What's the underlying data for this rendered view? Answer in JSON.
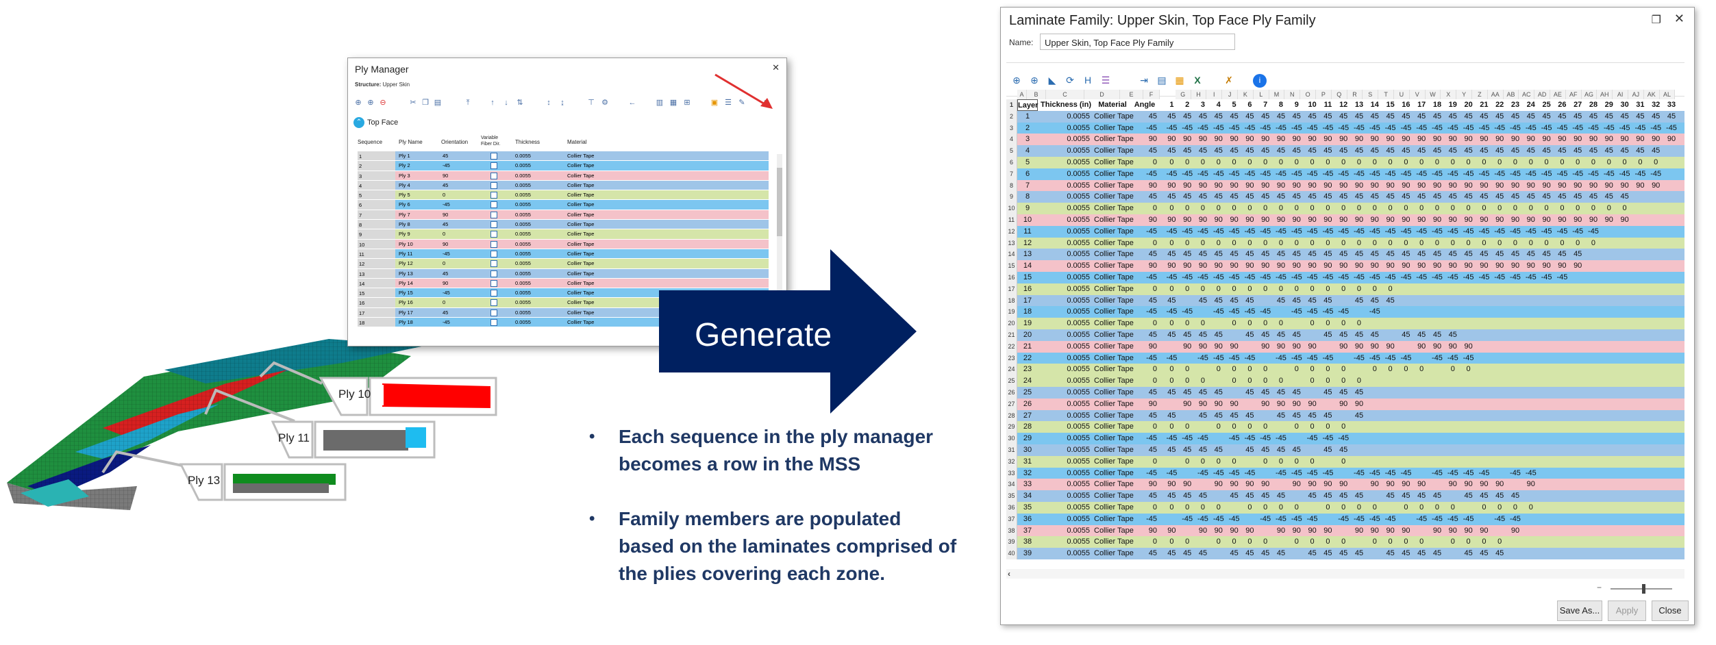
{
  "ply_manager": {
    "title": "Ply Manager",
    "structure_label": "Structure:",
    "structure_value": "Upper Skin",
    "group": "Top Face",
    "columns": [
      "Sequence",
      "Ply Name",
      "Orientation",
      "Variable Fiber Dir.",
      "Thickness",
      "Material"
    ],
    "rows": [
      {
        "seq": "1",
        "name": "Ply 1",
        "orient": "45",
        "thick": "0.0055",
        "mat": "Collier Tape",
        "color": "#9fc5e8"
      },
      {
        "seq": "2",
        "name": "Ply 2",
        "orient": "-45",
        "thick": "0.0055",
        "mat": "Collier Tape",
        "color": "#7cc6f0"
      },
      {
        "seq": "3",
        "name": "Ply 3",
        "orient": "90",
        "thick": "0.0055",
        "mat": "Collier Tape",
        "color": "#f4c2c9"
      },
      {
        "seq": "4",
        "name": "Ply 4",
        "orient": "45",
        "thick": "0.0055",
        "mat": "Collier Tape",
        "color": "#9fc5e8"
      },
      {
        "seq": "5",
        "name": "Ply 5",
        "orient": "0",
        "thick": "0.0055",
        "mat": "Collier Tape",
        "color": "#d5e5a9"
      },
      {
        "seq": "6",
        "name": "Ply 6",
        "orient": "-45",
        "thick": "0.0055",
        "mat": "Collier Tape",
        "color": "#7cc6f0"
      },
      {
        "seq": "7",
        "name": "Ply 7",
        "orient": "90",
        "thick": "0.0055",
        "mat": "Collier Tape",
        "color": "#f4c2c9"
      },
      {
        "seq": "8",
        "name": "Ply 8",
        "orient": "45",
        "thick": "0.0055",
        "mat": "Collier Tape",
        "color": "#9fc5e8"
      },
      {
        "seq": "9",
        "name": "Ply 9",
        "orient": "0",
        "thick": "0.0055",
        "mat": "Collier Tape",
        "color": "#d5e5a9"
      },
      {
        "seq": "10",
        "name": "Ply 10",
        "orient": "90",
        "thick": "0.0055",
        "mat": "Collier Tape",
        "color": "#f4c2c9"
      },
      {
        "seq": "11",
        "name": "Ply 11",
        "orient": "-45",
        "thick": "0.0055",
        "mat": "Collier Tape",
        "color": "#7cc6f0"
      },
      {
        "seq": "12",
        "name": "Ply 12",
        "orient": "0",
        "thick": "0.0055",
        "mat": "Collier Tape",
        "color": "#d5e5a9"
      },
      {
        "seq": "13",
        "name": "Ply 13",
        "orient": "45",
        "thick": "0.0055",
        "mat": "Collier Tape",
        "color": "#9fc5e8"
      },
      {
        "seq": "14",
        "name": "Ply 14",
        "orient": "90",
        "thick": "0.0055",
        "mat": "Collier Tape",
        "color": "#f4c2c9"
      },
      {
        "seq": "15",
        "name": "Ply 15",
        "orient": "-45",
        "thick": "0.0055",
        "mat": "Collier Tape",
        "color": "#7cc6f0"
      },
      {
        "seq": "16",
        "name": "Ply 16",
        "orient": "0",
        "thick": "0.0055",
        "mat": "Collier Tape",
        "color": "#d5e5a9"
      },
      {
        "seq": "17",
        "name": "Ply 17",
        "orient": "45",
        "thick": "0.0055",
        "mat": "Collier Tape",
        "color": "#9fc5e8"
      },
      {
        "seq": "18",
        "name": "Ply 18",
        "orient": "-45",
        "thick": "0.0055",
        "mat": "Collier Tape",
        "color": "#7cc6f0"
      }
    ]
  },
  "callouts": [
    "Ply 10",
    "Ply 11",
    "Ply 13"
  ],
  "generate_label": "Generate",
  "bullets": [
    "Each sequence in the ply manager becomes a row in the MSS",
    "Family members are populated based on the laminates comprised of the plies covering each zone."
  ],
  "laminate_family": {
    "title": "Laminate Family: Upper Skin, Top Face Ply Family",
    "name_label": "Name:",
    "name_value": "Upper Skin, Top Face Ply Family",
    "col_letters": [
      "A",
      "B",
      "C",
      "D",
      "E",
      "F",
      "G",
      "H",
      "I",
      "J",
      "K",
      "L",
      "M",
      "N",
      "O",
      "P",
      "Q",
      "R",
      "S",
      "T",
      "U",
      "V",
      "W",
      "X",
      "Y",
      "Z",
      "AA",
      "AB",
      "AC",
      "AD",
      "AE",
      "AF",
      "AG",
      "AH",
      "AI",
      "AJ",
      "AK",
      "AL"
    ],
    "header": {
      "layer": "Layer",
      "thickness": "Thickness (in)",
      "material": "Material",
      "angle": "Angle",
      "members": [
        "1",
        "2",
        "3",
        "4",
        "5",
        "6",
        "7",
        "8",
        "9",
        "10",
        "11",
        "12",
        "13",
        "14",
        "15",
        "16",
        "17",
        "18",
        "19",
        "20",
        "21",
        "22",
        "23",
        "24",
        "25",
        "26",
        "27",
        "28",
        "29",
        "30",
        "31",
        "32",
        "33"
      ]
    },
    "material": "Collier Tape",
    "thickness": "0.0055",
    "angles": [
      "45",
      "-45",
      "90",
      "45",
      "0",
      "-45",
      "90",
      "45",
      "0",
      "90",
      "-45",
      "0",
      "45",
      "90",
      "-45",
      "0",
      "45",
      "-45",
      "0",
      "45",
      "90",
      "-45",
      "0",
      "0",
      "45",
      "90",
      "45",
      "0",
      "-45",
      "45",
      "0",
      "-45",
      "90",
      "45",
      "0",
      "-45",
      "90",
      "0",
      "45"
    ],
    "members_count": [
      33,
      33,
      33,
      32,
      32,
      32,
      32,
      30,
      30,
      30,
      28,
      28,
      27,
      27,
      26,
      15,
      15,
      14,
      13,
      20,
      21,
      20,
      20,
      14,
      13,
      13,
      13,
      12,
      12,
      12,
      12,
      24,
      24,
      24,
      24,
      23,
      23,
      22,
      22
    ],
    "buttons": {
      "save": "Save As...",
      "apply": "Apply",
      "close": "Close"
    }
  },
  "colors": {
    "c45": "#9fc5e8",
    "cm45": "#7cc6f0",
    "c90": "#f4c2c9",
    "c0": "#d5e5a9",
    "navy": "#002060",
    "bulletText": "#1f3864"
  }
}
